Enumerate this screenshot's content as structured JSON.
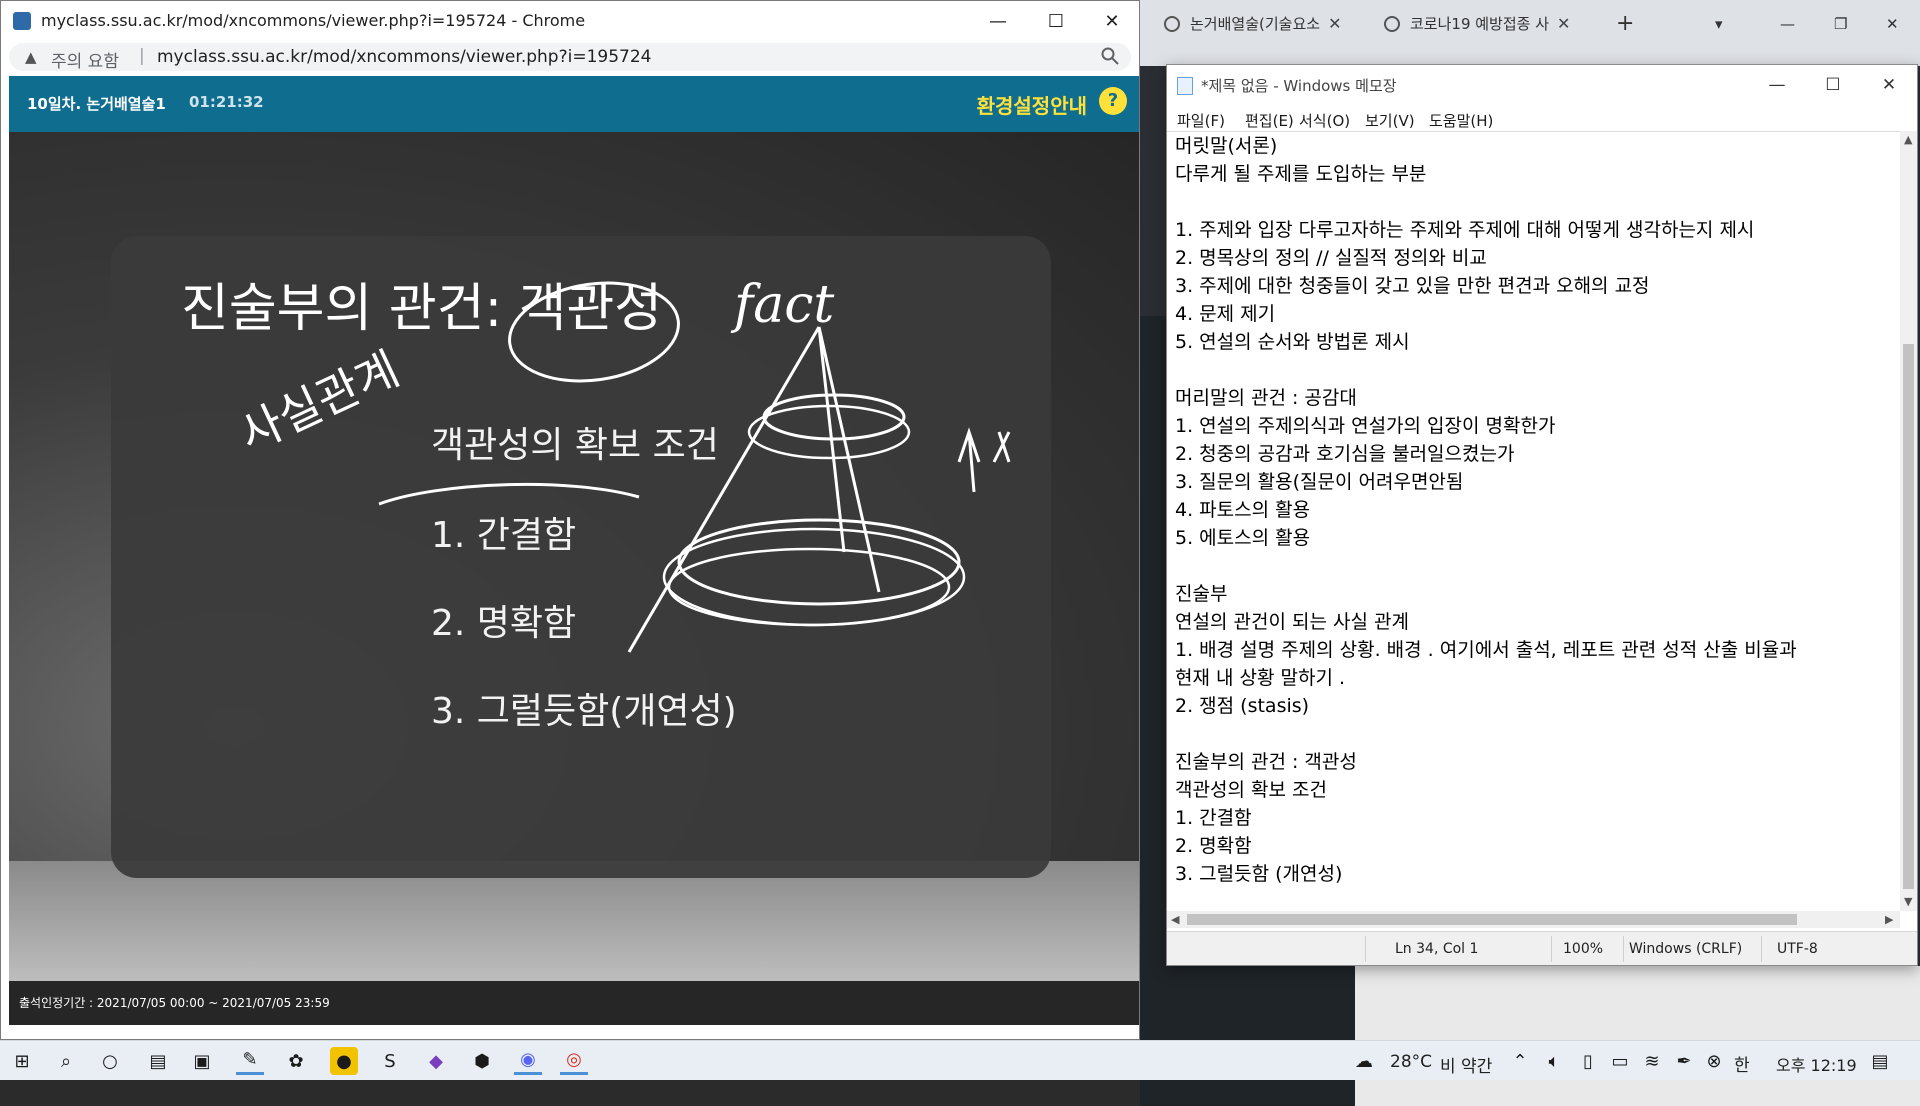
{
  "viewer": {
    "window_title": "myclass.ssu.ac.kr/mod/xncommons/viewer.php?i=195724 - Chrome",
    "security_warning": "주의 요함",
    "address_url": "myclass.ssu.ac.kr/mod/xncommons/viewer.php?i=195724",
    "lesson_title": "10일차. 논거배열술1",
    "elapsed_time": "01:21:32",
    "settings_label": "환경설정안내",
    "help_label": "?",
    "attendance_period": "출석인정기간 : 2021/07/05 00:00 ~ 2021/07/05 23:59",
    "slide": {
      "title": "진술부의 관건: 객관성",
      "subtitle": "객관성의 확보 조건",
      "items": [
        "1. 간결함",
        "2. 명확함",
        "3. 그럴듯함(개연성)"
      ],
      "handwriting_fact": "fact",
      "handwriting_note": "사실관계"
    }
  },
  "background_browser": {
    "tabs": [
      {
        "label": "논거배열술(기술요소"
      },
      {
        "label": "코로나19 예방접종 사"
      }
    ],
    "new_tab": "+"
  },
  "notepad": {
    "title": "*제목 없음 - Windows 메모장",
    "menu": [
      "파일(F)",
      "편집(E)",
      "서식(O)",
      "보기(V)",
      "도움말(H)"
    ],
    "lines": [
      "머릿말(서론)",
      "다루게 될 주제를 도입하는 부분",
      "",
      "1. 주제와 입장 다루고자하는 주제와 주제에 대해 어떻게 생각하는지 제시",
      "2. 명목상의 정의 // 실질적 정의와 비교",
      "3. 주제에 대한 청중들이 갖고 있을 만한 편견과 오해의 교정",
      "4. 문제 제기",
      "5. 연설의 순서와 방법론 제시",
      "",
      "머리말의 관건 : 공감대",
      "1. 연설의 주제의식과 연설가의 입장이 명확한가",
      "2. 청중의 공감과 호기심을 불러일으켰는가",
      "3. 질문의 활용(질문이 어려우면안됨",
      "4. 파토스의 활용",
      "5. 에토스의 활용",
      "",
      "진술부",
      "연설의 관건이 되는 사실 관계",
      "1. 배경 설명 주제의 상황. 배경 . 여기에서 출석, 레포트 관련 성적 산출 비율과",
      "현재 내 상황 말하기 .",
      "2. 쟁점 (stasis)",
      "",
      "진술부의 관건 : 객관성",
      "객관성의 확보 조건",
      "1. 간결함",
      "2. 명확함",
      "3. 그럴듯함 (개연성)"
    ],
    "status": {
      "position": "Ln 34, Col 1",
      "zoom": "100%",
      "line_ending": "Windows (CRLF)",
      "encoding": "UTF-8"
    }
  },
  "taskbar": {
    "temperature": "28°C",
    "weather": "비 약간",
    "ime": "한",
    "clock": "오후 12:19"
  },
  "colors": {
    "player_header": "#0f6e90",
    "settings_accent": "#ffe13a"
  }
}
